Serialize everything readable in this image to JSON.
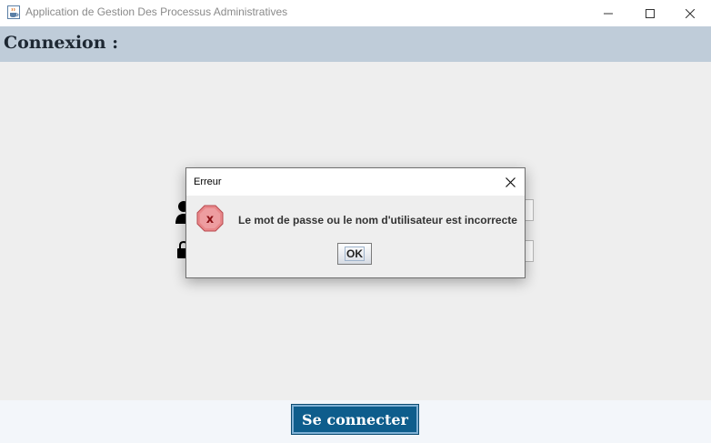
{
  "window": {
    "title": "Application de Gestion Des Processus Administratives",
    "app_icon": "java-cup-icon",
    "controls": [
      "minimize-icon",
      "maximize-icon",
      "close-icon"
    ]
  },
  "header": {
    "title": "Connexion :"
  },
  "login_form": {
    "username_icon": "user-icon",
    "username_value": "",
    "password_icon": "lock-icon",
    "password_value": ""
  },
  "footer": {
    "connect_label": "Se connecter"
  },
  "dialog": {
    "title": "Erreur",
    "icon": "error-icon",
    "message": "Le mot de passe ou le nom d'utilisateur est incorrecte",
    "ok_label": "OK"
  },
  "colors": {
    "header_bg": "#bfccd9",
    "content_bg": "#eeeeee",
    "footer_bg": "#f3f6fa",
    "connect_button_bg": "#0e5d8c",
    "error_icon": "#e06a6e"
  }
}
